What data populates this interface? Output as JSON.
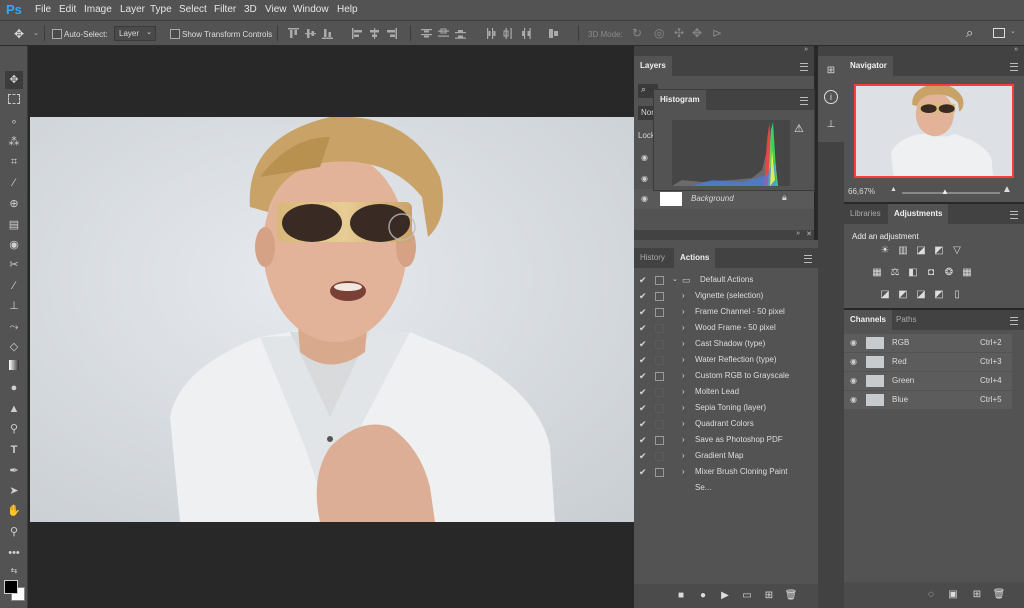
{
  "app": {
    "logo": "Ps"
  },
  "menu": [
    "File",
    "Edit",
    "Image",
    "Layer",
    "Type",
    "Select",
    "Filter",
    "3D",
    "View",
    "Window",
    "Help"
  ],
  "options": {
    "auto_select_label": "Auto-Select:",
    "layer_select_value": "Layer",
    "transform_label": "Show Transform Controls",
    "mode_3d_label": "3D Mode:"
  },
  "layers_panel": {
    "tab": "Layers",
    "search_placeholder": "",
    "kind_value": "Nor",
    "lock_label": "Lock:",
    "background_layer": "Background"
  },
  "histogram_panel": {
    "tab": "Histogram"
  },
  "history_actions": {
    "tabs": [
      "History",
      "Actions"
    ],
    "set_name": "Default Actions",
    "actions": [
      "Vignette (selection)",
      "Frame Channel - 50 pixel",
      "Wood Frame - 50 pixel",
      "Cast Shadow (type)",
      "Water Reflection (type)",
      "Custom RGB to Grayscale",
      "Molten Lead",
      "Sepia Toning (layer)",
      "Quadrant Colors",
      "Save as Photoshop PDF",
      "Gradient Map",
      "Mixer Brush Cloning Paint Se..."
    ],
    "dialog_flags": [
      true,
      true,
      false,
      false,
      false,
      true,
      false,
      false,
      false,
      true,
      false,
      true
    ]
  },
  "navigator": {
    "tab": "Navigator",
    "zoom": "66,67%"
  },
  "adjustments": {
    "tabs": [
      "Libraries",
      "Adjustments"
    ],
    "title": "Add an adjustment"
  },
  "channels": {
    "tabs": [
      "Channels",
      "Paths"
    ],
    "items": [
      {
        "name": "RGB",
        "shortcut": "Ctrl+2"
      },
      {
        "name": "Red",
        "shortcut": "Ctrl+3"
      },
      {
        "name": "Green",
        "shortcut": "Ctrl+4"
      },
      {
        "name": "Blue",
        "shortcut": "Ctrl+5"
      }
    ]
  },
  "colors": {
    "accent": "#31a8ff",
    "panel": "#535353",
    "navigator_frame": "#ff3b3b"
  }
}
